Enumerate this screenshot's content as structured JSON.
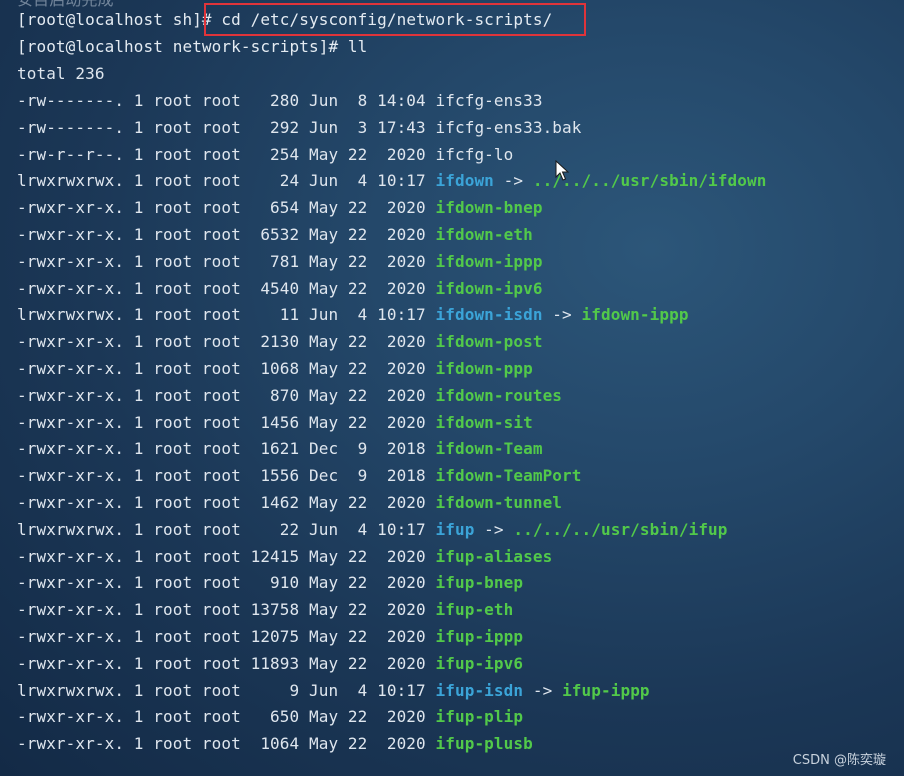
{
  "terminal": {
    "top_line": "安目启动完成",
    "prompt1": "[root@localhost sh]# ",
    "command1": "cd /etc/sysconfig/network-scripts/",
    "prompt2": "[root@localhost network-scripts]# ",
    "command2": "ll",
    "total": "total 236",
    "entries": [
      {
        "info": "-rw-------. 1 root root   280 Jun  8 14:04 ",
        "name": "ifcfg-ens33",
        "kind": "plain"
      },
      {
        "info": "-rw-------. 1 root root   292 Jun  3 17:43 ",
        "name": "ifcfg-ens33.bak",
        "kind": "plain"
      },
      {
        "info": "-rw-r--r--. 1 root root   254 May 22  2020 ",
        "name": "ifcfg-lo",
        "kind": "plain"
      },
      {
        "info": "lrwxrwxrwx. 1 root root    24 Jun  4 10:17 ",
        "name": "ifdown",
        "kind": "link",
        "arrow": " -> ",
        "target": "../../../usr/sbin/ifdown"
      },
      {
        "info": "-rwxr-xr-x. 1 root root   654 May 22  2020 ",
        "name": "ifdown-bnep",
        "kind": "exec"
      },
      {
        "info": "-rwxr-xr-x. 1 root root  6532 May 22  2020 ",
        "name": "ifdown-eth",
        "kind": "exec"
      },
      {
        "info": "-rwxr-xr-x. 1 root root   781 May 22  2020 ",
        "name": "ifdown-ippp",
        "kind": "exec"
      },
      {
        "info": "-rwxr-xr-x. 1 root root  4540 May 22  2020 ",
        "name": "ifdown-ipv6",
        "kind": "exec"
      },
      {
        "info": "lrwxrwxrwx. 1 root root    11 Jun  4 10:17 ",
        "name": "ifdown-isdn",
        "kind": "link",
        "arrow": " -> ",
        "target": "ifdown-ippp"
      },
      {
        "info": "-rwxr-xr-x. 1 root root  2130 May 22  2020 ",
        "name": "ifdown-post",
        "kind": "exec"
      },
      {
        "info": "-rwxr-xr-x. 1 root root  1068 May 22  2020 ",
        "name": "ifdown-ppp",
        "kind": "exec"
      },
      {
        "info": "-rwxr-xr-x. 1 root root   870 May 22  2020 ",
        "name": "ifdown-routes",
        "kind": "exec"
      },
      {
        "info": "-rwxr-xr-x. 1 root root  1456 May 22  2020 ",
        "name": "ifdown-sit",
        "kind": "exec"
      },
      {
        "info": "-rwxr-xr-x. 1 root root  1621 Dec  9  2018 ",
        "name": "ifdown-Team",
        "kind": "exec"
      },
      {
        "info": "-rwxr-xr-x. 1 root root  1556 Dec  9  2018 ",
        "name": "ifdown-TeamPort",
        "kind": "exec"
      },
      {
        "info": "-rwxr-xr-x. 1 root root  1462 May 22  2020 ",
        "name": "ifdown-tunnel",
        "kind": "exec"
      },
      {
        "info": "lrwxrwxrwx. 1 root root    22 Jun  4 10:17 ",
        "name": "ifup",
        "kind": "link",
        "arrow": " -> ",
        "target": "../../../usr/sbin/ifup"
      },
      {
        "info": "-rwxr-xr-x. 1 root root 12415 May 22  2020 ",
        "name": "ifup-aliases",
        "kind": "exec"
      },
      {
        "info": "-rwxr-xr-x. 1 root root   910 May 22  2020 ",
        "name": "ifup-bnep",
        "kind": "exec"
      },
      {
        "info": "-rwxr-xr-x. 1 root root 13758 May 22  2020 ",
        "name": "ifup-eth",
        "kind": "exec"
      },
      {
        "info": "-rwxr-xr-x. 1 root root 12075 May 22  2020 ",
        "name": "ifup-ippp",
        "kind": "exec"
      },
      {
        "info": "-rwxr-xr-x. 1 root root 11893 May 22  2020 ",
        "name": "ifup-ipv6",
        "kind": "exec"
      },
      {
        "info": "lrwxrwxrwx. 1 root root     9 Jun  4 10:17 ",
        "name": "ifup-isdn",
        "kind": "link",
        "arrow": " -> ",
        "target": "ifup-ippp"
      },
      {
        "info": "-rwxr-xr-x. 1 root root   650 May 22  2020 ",
        "name": "ifup-plip",
        "kind": "exec"
      },
      {
        "info": "-rwxr-xr-x. 1 root root  1064 May 22  2020 ",
        "name": "ifup-plusb",
        "kind": "exec"
      }
    ]
  },
  "cursor_icon": "mouse-pointer-icon",
  "watermark": "CSDN @陈奕璇",
  "colors": {
    "executable": "#52c94a",
    "symlink": "#3ba4d8",
    "highlight_box": "#e0343a"
  }
}
